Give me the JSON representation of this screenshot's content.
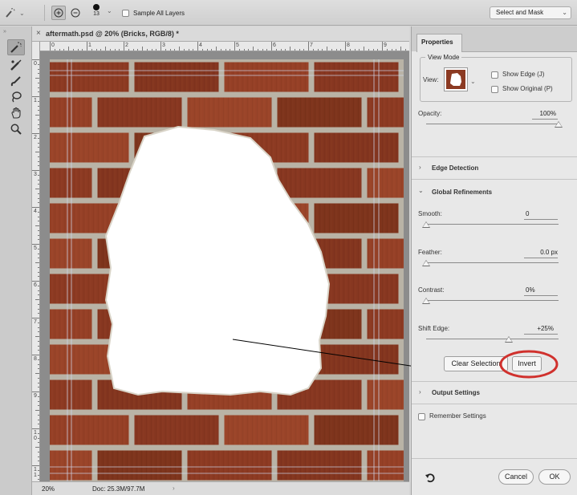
{
  "options_bar": {
    "brush_size": "13",
    "sample_all_layers": "Sample All Layers",
    "select_and_mask": "Select and Mask"
  },
  "toolbar": {
    "tools": [
      "quick-selection-brush",
      "refine-edge-brush",
      "brush",
      "lasso",
      "hand",
      "zoom"
    ]
  },
  "document": {
    "tab_title": "aftermath.psd @ 20% (Bricks, RGB/8) *",
    "ruler_top": [
      "0",
      "1",
      "2",
      "3",
      "4",
      "5",
      "6",
      "7",
      "8",
      "9"
    ],
    "ruler_left": [
      "0",
      "1",
      "2",
      "3",
      "4",
      "5",
      "6",
      "7",
      "8",
      "9",
      "1\n0",
      "1\n1"
    ],
    "zoom": "20%",
    "doc_size": "Doc: 25.3M/97.7M"
  },
  "properties": {
    "tab": "Properties",
    "view_mode": {
      "title": "View Mode",
      "view_label": "View:",
      "show_edge": "Show Edge (J)",
      "show_original": "Show Original (P)"
    },
    "opacity": {
      "label": "Opacity:",
      "value": "100%",
      "level": 1.0
    },
    "edge_detection": "Edge Detection",
    "global_refinements": "Global Refinements",
    "smooth": {
      "label": "Smooth:",
      "value": "0",
      "level": 0.0
    },
    "feather": {
      "label": "Feather:",
      "value": "0.0 px",
      "level": 0.0
    },
    "contrast": {
      "label": "Contrast:",
      "value": "0%",
      "level": 0.0
    },
    "shift_edge": {
      "label": "Shift Edge:",
      "value": "+25%",
      "level": 0.625
    },
    "clear_selection": "Clear Selection",
    "invert": "Invert",
    "output_settings": "Output Settings",
    "remember_settings": "Remember Settings",
    "cancel": "Cancel",
    "ok": "OK"
  },
  "colors": {
    "highlight_circle": "#d0312d",
    "brick": "#8c3a22",
    "mortar": "#b9b3a6"
  }
}
